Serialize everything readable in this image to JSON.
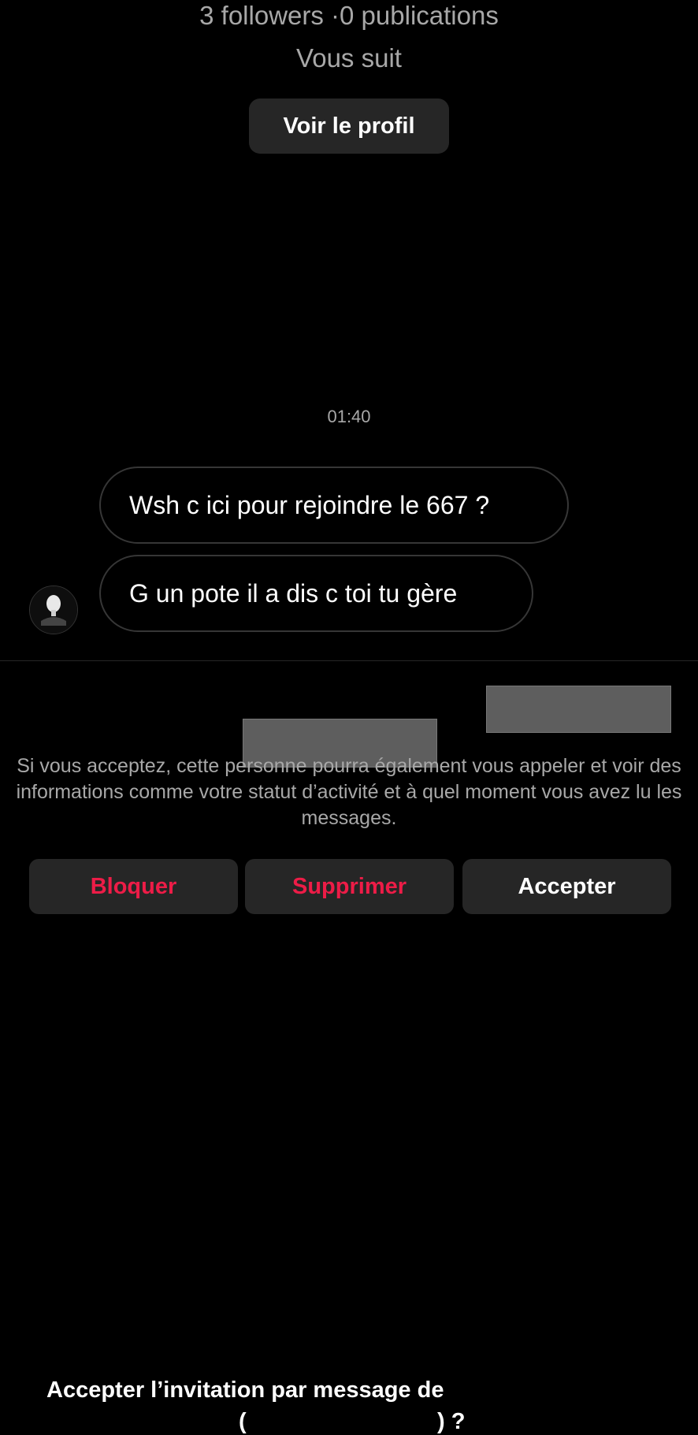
{
  "profile": {
    "stats": "3 followers ·0 publications",
    "follows_you": "Vous suit",
    "view_profile_label": "Voir le profil"
  },
  "thread": {
    "timestamp": "01:40",
    "messages": [
      {
        "text": "Wsh c ici pour rejoindre le 667 ?"
      },
      {
        "text": "G un pote il a dis c toi tu gère"
      }
    ]
  },
  "invitation": {
    "title_prefix": "Accepter l’invitation par message de",
    "title_open_paren": "(",
    "title_suffix": ") ?",
    "description": "Si vous acceptez, cette personne pourra également vous appeler et voir des informations comme votre statut d’activité et à quel moment vous avez lu les messages."
  },
  "actions": {
    "block_label": "Bloquer",
    "delete_label": "Supprimer",
    "accept_label": "Accepter"
  },
  "colors": {
    "background": "#000000",
    "button_bg": "#262626",
    "danger": "#ed1c47",
    "muted_text": "#a8a8a8"
  },
  "icons": {
    "avatar": "profile-avatar"
  }
}
